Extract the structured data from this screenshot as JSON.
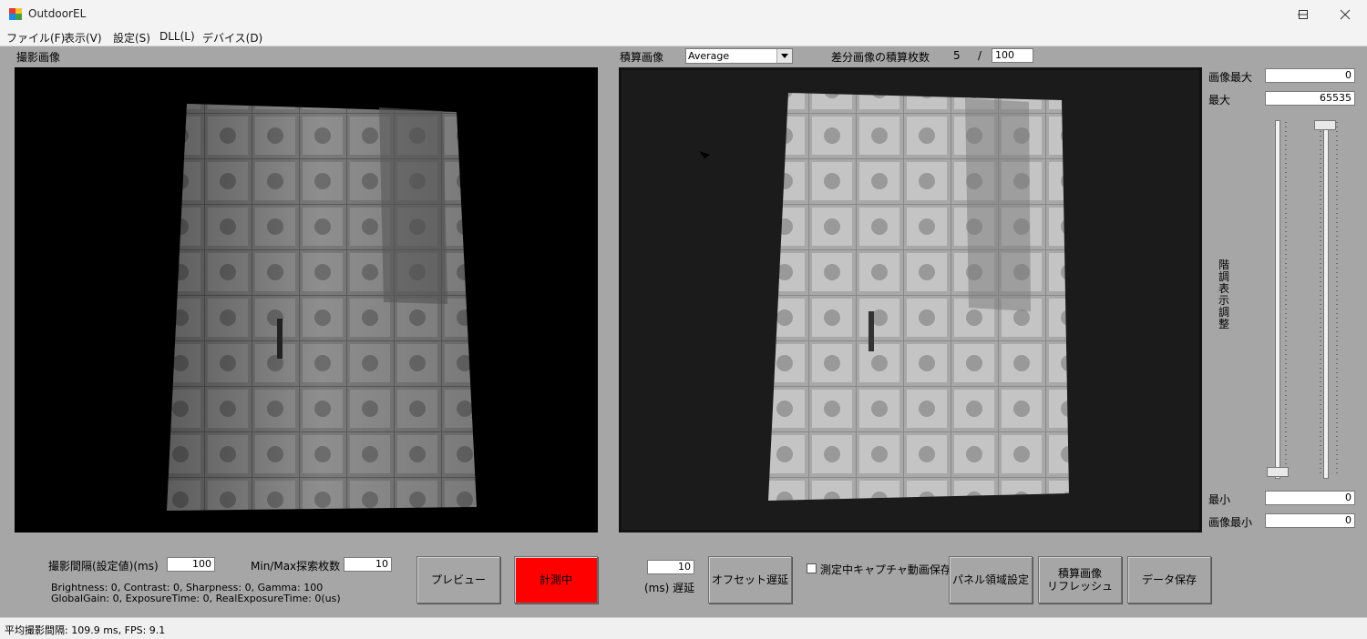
{
  "window": {
    "title": "OutdoorEL"
  },
  "menu": [
    "ファイル(F)",
    "表示(V)",
    "設定(S)",
    "DLL(L)",
    "デバイス(D)"
  ],
  "capture": {
    "label": "撮影画像"
  },
  "integration": {
    "label": "積算画像",
    "mode": "Average",
    "diff_label": "差分画像の積算枚数",
    "count": "5",
    "separator": "/",
    "total": "100"
  },
  "display_adjust": {
    "image_max_label": "画像最大",
    "image_max": "0",
    "max_label": "最大",
    "max": "65535",
    "vertical_label": "階調表示調整",
    "min_label": "最小",
    "min": "0",
    "image_min_label": "画像最小",
    "image_min": "0"
  },
  "controls": {
    "interval_label": "撮影間隔(設定値)(ms)",
    "interval": "100",
    "minmax_label": "Min/Max探索枚数",
    "minmax": "10",
    "camera_info_1": "Brightness: 0, Contrast: 0, Sharpness: 0, Gamma: 100",
    "camera_info_2": "GlobalGain: 0, ExposureTime: 0, RealExposureTime: 0(us)",
    "preview_button": "プレビュー",
    "measuring_button": "計測中",
    "delay_value": "10",
    "delay_label": "(ms) 遅延",
    "offset_delay_button": "オフセット遅延",
    "video_save_label": "測定中キャプチャ動画保存",
    "panel_area_button": "パネル領域設定",
    "refresh_button": "積算画像\nリフレッシュ",
    "data_save_button": "データ保存"
  },
  "status": {
    "text": "平均撮影間隔: 109.9 ms, FPS: 9.1"
  },
  "colors": {
    "accent_red": "#ff0000",
    "background": "#a6a6a6"
  }
}
